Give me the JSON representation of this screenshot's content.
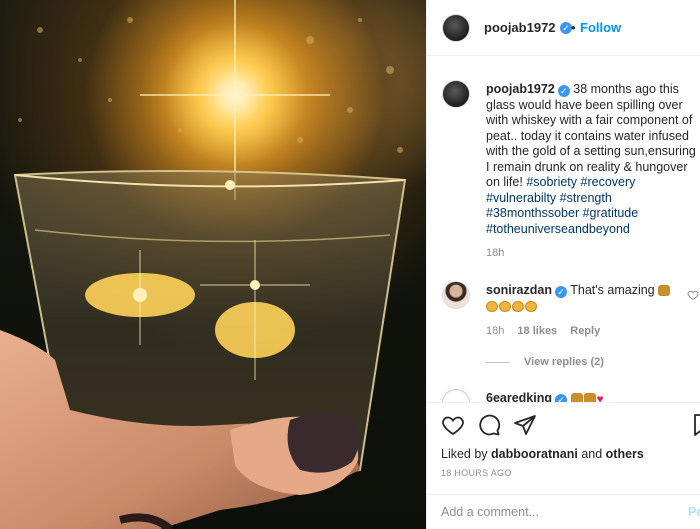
{
  "post": {
    "author": "poojab1972",
    "follow_label": "Follow",
    "separator": "•",
    "caption_text": " 38 months ago this glass would have been spilling over with whiskey with a fair component of peat.. today it contains water infused with the gold of a setting sun,ensuring I remain drunk on reality & hungover on life! ",
    "hashtags": [
      "#sobriety",
      "#recovery",
      "#vulnerabilty",
      "#strength",
      "#38monthssober",
      "#gratitude",
      "#totheuniverseandbeyond"
    ],
    "caption_time": "18h",
    "liked_by_prefix": "Liked by ",
    "liked_by_user": "dabbooratnani",
    "liked_by_suffix": " and ",
    "liked_by_others": "others",
    "timestamp": "18 HOURS AGO"
  },
  "comments": [
    {
      "author": "sonirazdan",
      "text": "That's amazing",
      "time": "18h",
      "likes": "18 likes",
      "reply_label": "Reply",
      "view_replies": "View replies (2)"
    },
    {
      "author": "6earedking"
    }
  ],
  "composer": {
    "placeholder": "Add a comment...",
    "post_label": "Post"
  },
  "colors": {
    "link": "#00376b",
    "accent": "#0095f6",
    "verified": "#3897f0",
    "muted": "#8e8e8e"
  }
}
